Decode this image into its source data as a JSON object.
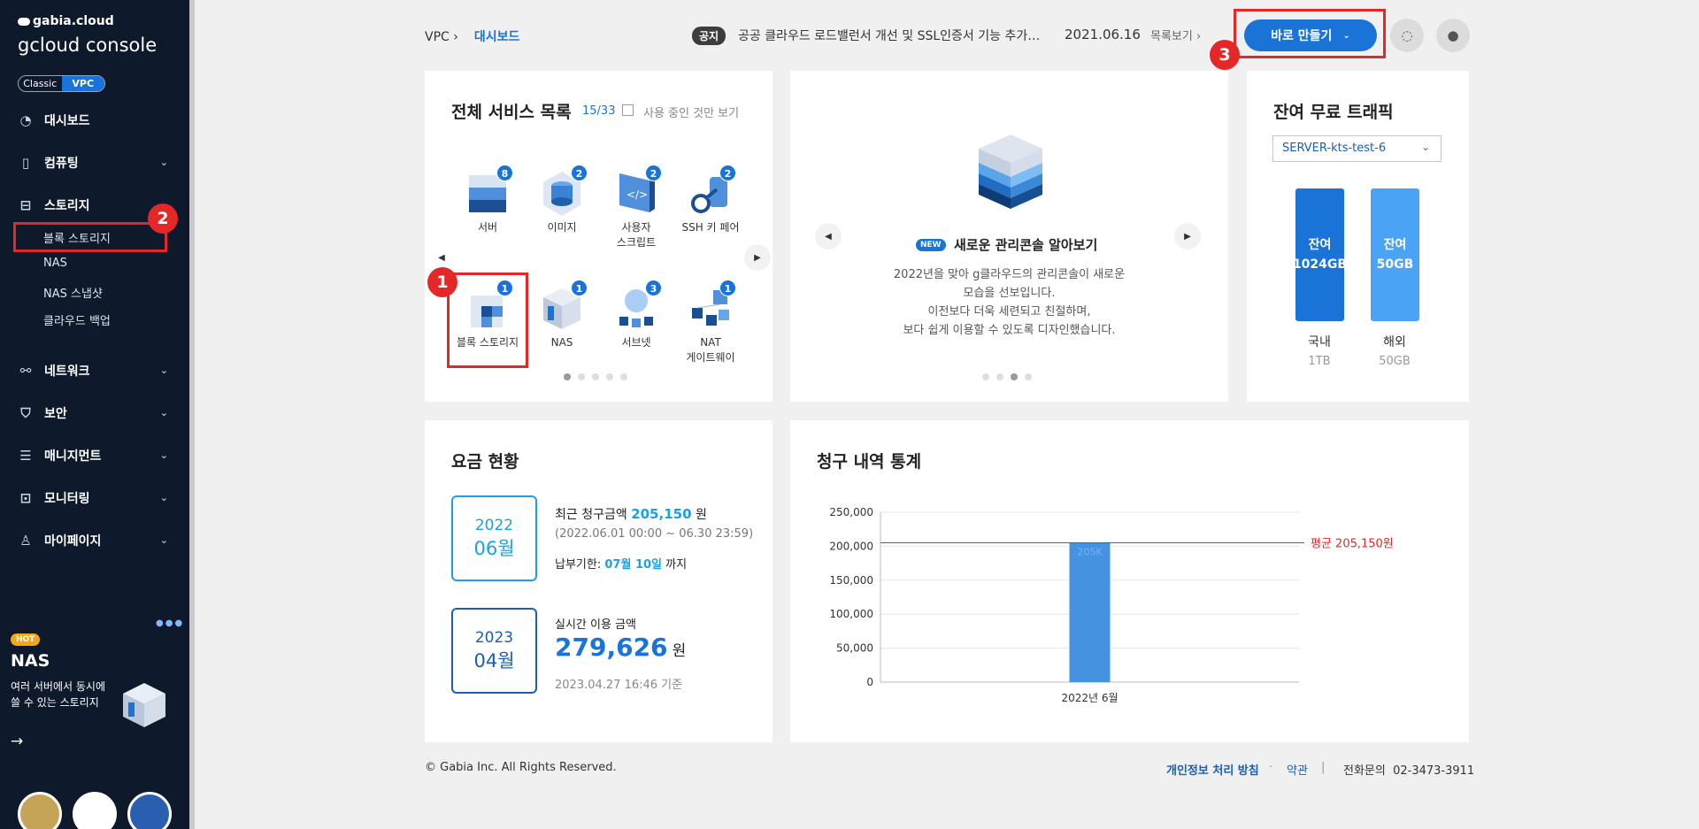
{
  "sidebar": {
    "brand": "gabia.cloud",
    "console": "gcloud console",
    "toggle": {
      "classic": "Classic",
      "vpc": "VPC"
    },
    "items": [
      {
        "label": "대시보드"
      },
      {
        "label": "컴퓨팅"
      },
      {
        "label": "스토리지"
      },
      {
        "label": "네트워크"
      },
      {
        "label": "보안"
      },
      {
        "label": "매니지먼트"
      },
      {
        "label": "모니터링"
      },
      {
        "label": "마이페이지"
      }
    ],
    "storage_sub": [
      "블록 스토리지",
      "NAS",
      "NAS 스냅샷",
      "클라우드 백업"
    ],
    "promo": {
      "tag": "HOT",
      "title": "NAS",
      "desc": "여러 서버에서 동시에 쓸 수 있는 스토리지"
    }
  },
  "annotations": {
    "one": "1",
    "two": "2",
    "three": "3"
  },
  "header": {
    "breadcrumb_root": "VPC",
    "breadcrumb_current": "대시보드",
    "notice_tag": "공지",
    "notice_text": "공공 클라우드 로드밸런서 개선 및 SSL인증서 기능 추가 안내",
    "notice_date": "2021.06.16",
    "notice_list": "목록보기",
    "make_button": "바로 만들기"
  },
  "services": {
    "title": "전체 서비스 목록",
    "count": "15/33",
    "filter_label": "사용 중인 것만 보기",
    "items": [
      {
        "label": "서버",
        "count": "8"
      },
      {
        "label": "이미지",
        "count": "2"
      },
      {
        "label": "사용자\n스크립트",
        "count": "2"
      },
      {
        "label": "SSH 키 페어",
        "count": "2"
      },
      {
        "label": "블록 스토리지",
        "count": "1"
      },
      {
        "label": "NAS",
        "count": "1"
      },
      {
        "label": "서브넷",
        "count": "3"
      },
      {
        "label": "NAT\n게이트웨이",
        "count": "1"
      }
    ]
  },
  "banner": {
    "new_tag": "NEW",
    "title": "새로운 관리콘솔 알아보기",
    "lines": [
      "2022년을 맞아 g클라우드의 관리콘솔이 새로운",
      "모습을 선보입니다.",
      "이전보다 더욱 세련되고 친절하며,",
      "보다 쉽게 이용할 수 있도록 디자인했습니다."
    ]
  },
  "traffic": {
    "title": "잔여 무료 트래픽",
    "server": "SERVER-kts-test-6",
    "domestic": {
      "bar": "잔여\n1024GB",
      "label": "국내",
      "total": "1TB"
    },
    "overseas": {
      "bar": "잔여\n50GB",
      "label": "해외",
      "total": "50GB"
    },
    "colors": {
      "domestic": "#1a74d8",
      "overseas": "#4aa3f5"
    }
  },
  "billing": {
    "title": "요금 현황",
    "recent": {
      "year": "2022",
      "month": "06월",
      "label": "최근 청구금액",
      "amount": "205,150",
      "unit": "원",
      "period": "(2022.06.01 00:00 ~ 06.30 23:59)",
      "due_label": "납부기한:",
      "due": "07월 10일",
      "due_suffix": "까지"
    },
    "realtime": {
      "year": "2023",
      "month": "04월",
      "label": "실시간 이용 금액",
      "amount": "279,626",
      "unit": "원",
      "asof": "2023.04.27 16:46 기준"
    }
  },
  "stats": {
    "title": "청구 내역 통계"
  },
  "chart_data": {
    "type": "bar",
    "categories": [
      "2022년 6월"
    ],
    "values": [
      205150
    ],
    "bar_label": "205K",
    "ylim": [
      0,
      250000
    ],
    "yticks": [
      "0",
      "50,000",
      "100,000",
      "150,000",
      "200,000",
      "250,000"
    ],
    "average": {
      "value": 205150,
      "label": "평균 205,150원",
      "color": "#e42828"
    },
    "bar_color": "#4593e0"
  },
  "footer": {
    "copyright": "© Gabia Inc. All Rights Reserved.",
    "privacy": "개인정보 처리 방침",
    "terms": "약관",
    "phone": "전화문의  02-3473-3911"
  }
}
